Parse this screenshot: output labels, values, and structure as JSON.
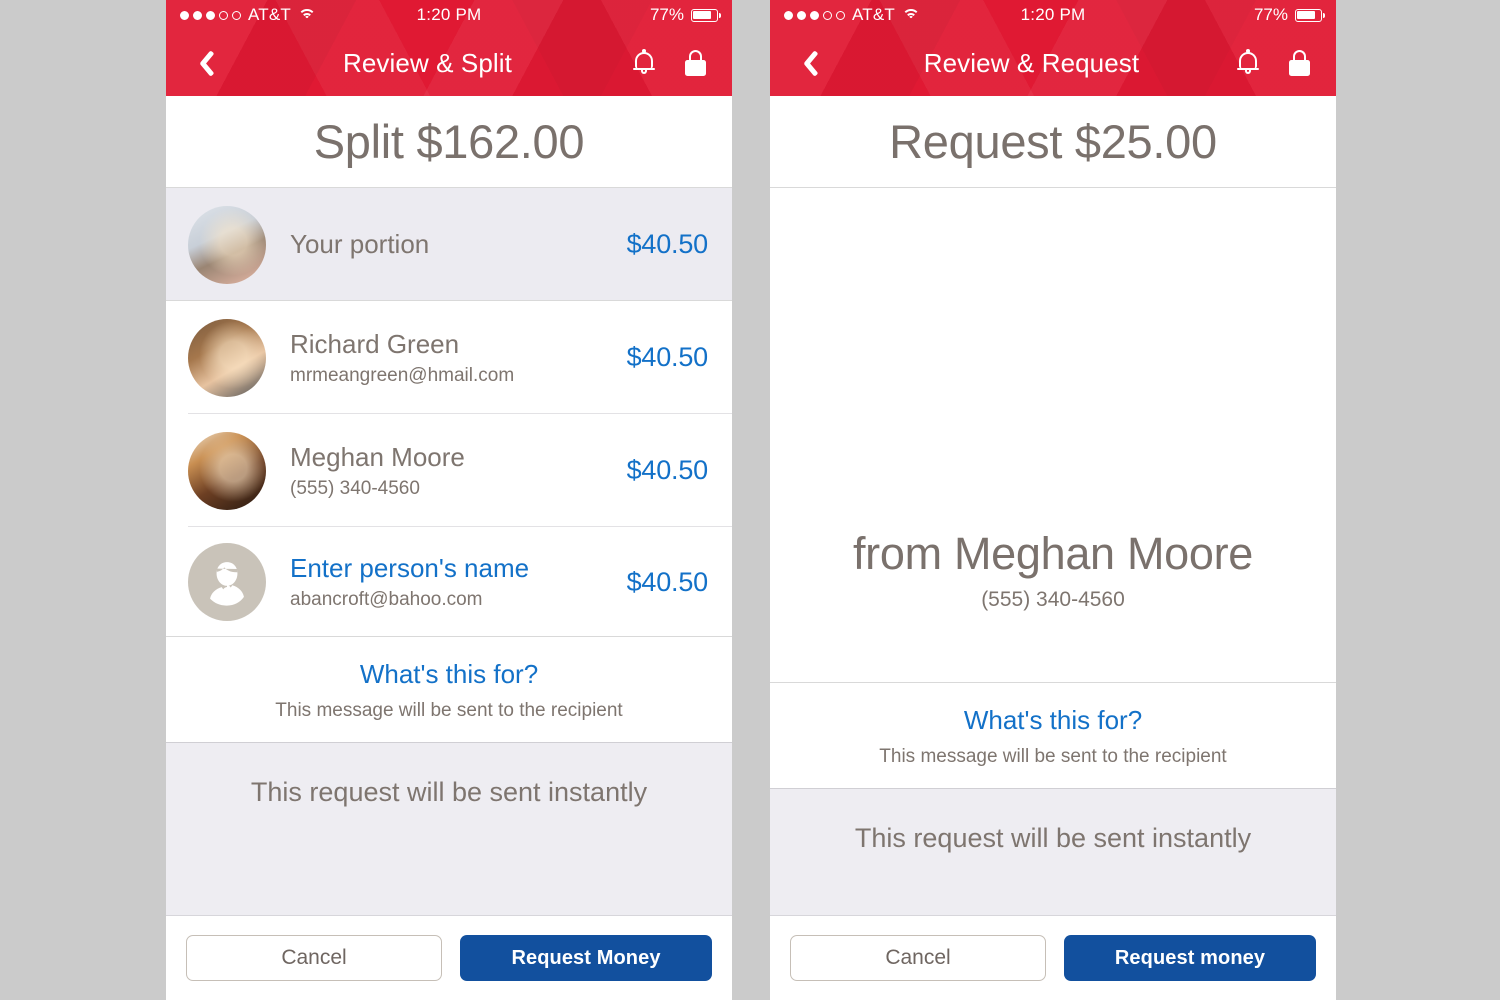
{
  "screens": [
    {
      "id": "review-split",
      "status_bar": {
        "signal_dots_filled": 3,
        "signal_dots_total": 5,
        "carrier": "AT&T",
        "wifi_icon": "wifi-icon",
        "time": "1:20 PM",
        "battery_percent": "77%",
        "battery_level": 77
      },
      "nav": {
        "back_icon": "back-chevron-icon",
        "title": "Review & Split",
        "bell_icon": "bell-icon",
        "lock_icon": "lock-icon"
      },
      "amount_heading": "Split $162.00",
      "rows": [
        {
          "name": "Your portion",
          "sub": "",
          "amount": "$40.50",
          "avatar": "photo-man-light",
          "highlight": true,
          "is_link": false
        },
        {
          "name": "Richard Green",
          "sub": "mrmeangreen@hmail.com",
          "amount": "$40.50",
          "avatar": "photo-man-beard",
          "highlight": false,
          "is_link": false
        },
        {
          "name": "Meghan Moore",
          "sub": "(555) 340-4560",
          "amount": "$40.50",
          "avatar": "photo-woman-curly",
          "highlight": false,
          "is_link": false
        },
        {
          "name": "Enter person's name",
          "sub": "abancroft@bahoo.com",
          "amount": "$40.50",
          "avatar": "person-placeholder-icon",
          "highlight": false,
          "is_link": true
        }
      ],
      "message": {
        "link": "What's this for?",
        "hint": "This message will be sent to the recipient"
      },
      "instant_notice": "This request will be sent instantly",
      "footer": {
        "cancel_label": "Cancel",
        "primary_label": "Request Money"
      }
    },
    {
      "id": "review-request",
      "status_bar": {
        "signal_dots_filled": 3,
        "signal_dots_total": 5,
        "carrier": "AT&T",
        "wifi_icon": "wifi-icon",
        "time": "1:20 PM",
        "battery_percent": "77%",
        "battery_level": 77
      },
      "nav": {
        "back_icon": "back-chevron-icon",
        "title": "Review & Request",
        "bell_icon": "bell-icon",
        "lock_icon": "lock-icon"
      },
      "amount_heading": "Request $25.00",
      "contact": {
        "avatar": "photo-woman-curly",
        "name": "from Meghan Moore",
        "sub": "(555) 340-4560"
      },
      "message": {
        "link": "What's this for?",
        "hint": "This message will be sent to the recipient"
      },
      "instant_notice": "This request will be sent instantly",
      "footer": {
        "cancel_label": "Cancel",
        "primary_label": "Request money"
      }
    }
  ],
  "colors": {
    "header_red": "#e01933",
    "accent_blue": "#1371c8",
    "primary_button_blue": "#12509e",
    "text_warm_gray": "#7e756f",
    "row_highlight": "#ecebf1",
    "instant_band": "#eeedf2",
    "page_background": "#cbcbcb"
  }
}
